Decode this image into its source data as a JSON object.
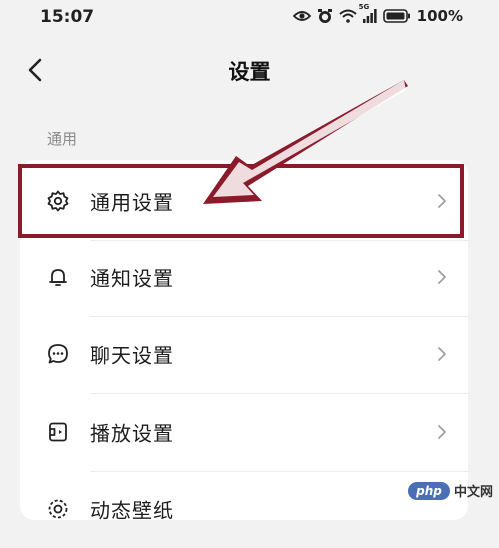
{
  "status_bar": {
    "time": "15:07",
    "battery_text": "100%",
    "network_badge": "5G",
    "icons": [
      "eye-icon",
      "alarm-icon",
      "wifi-icon",
      "signal-icon",
      "battery-icon"
    ]
  },
  "nav": {
    "title": "设置",
    "back_icon": "chevron-left-icon"
  },
  "section": {
    "label": "通用"
  },
  "items": [
    {
      "label": "通用设置",
      "icon": "gear-icon",
      "highlighted": true
    },
    {
      "label": "通知设置",
      "icon": "bell-icon",
      "highlighted": false
    },
    {
      "label": "聊天设置",
      "icon": "chat-bubble-icon",
      "highlighted": false
    },
    {
      "label": "播放设置",
      "icon": "play-settings-icon",
      "highlighted": false
    },
    {
      "label": "动态壁纸",
      "icon": "wallpaper-icon",
      "highlighted": false
    }
  ],
  "annotation": {
    "color": "#8b1a2b",
    "target": "通用设置"
  },
  "watermark": {
    "logo_text": "php",
    "text": "中文网"
  }
}
